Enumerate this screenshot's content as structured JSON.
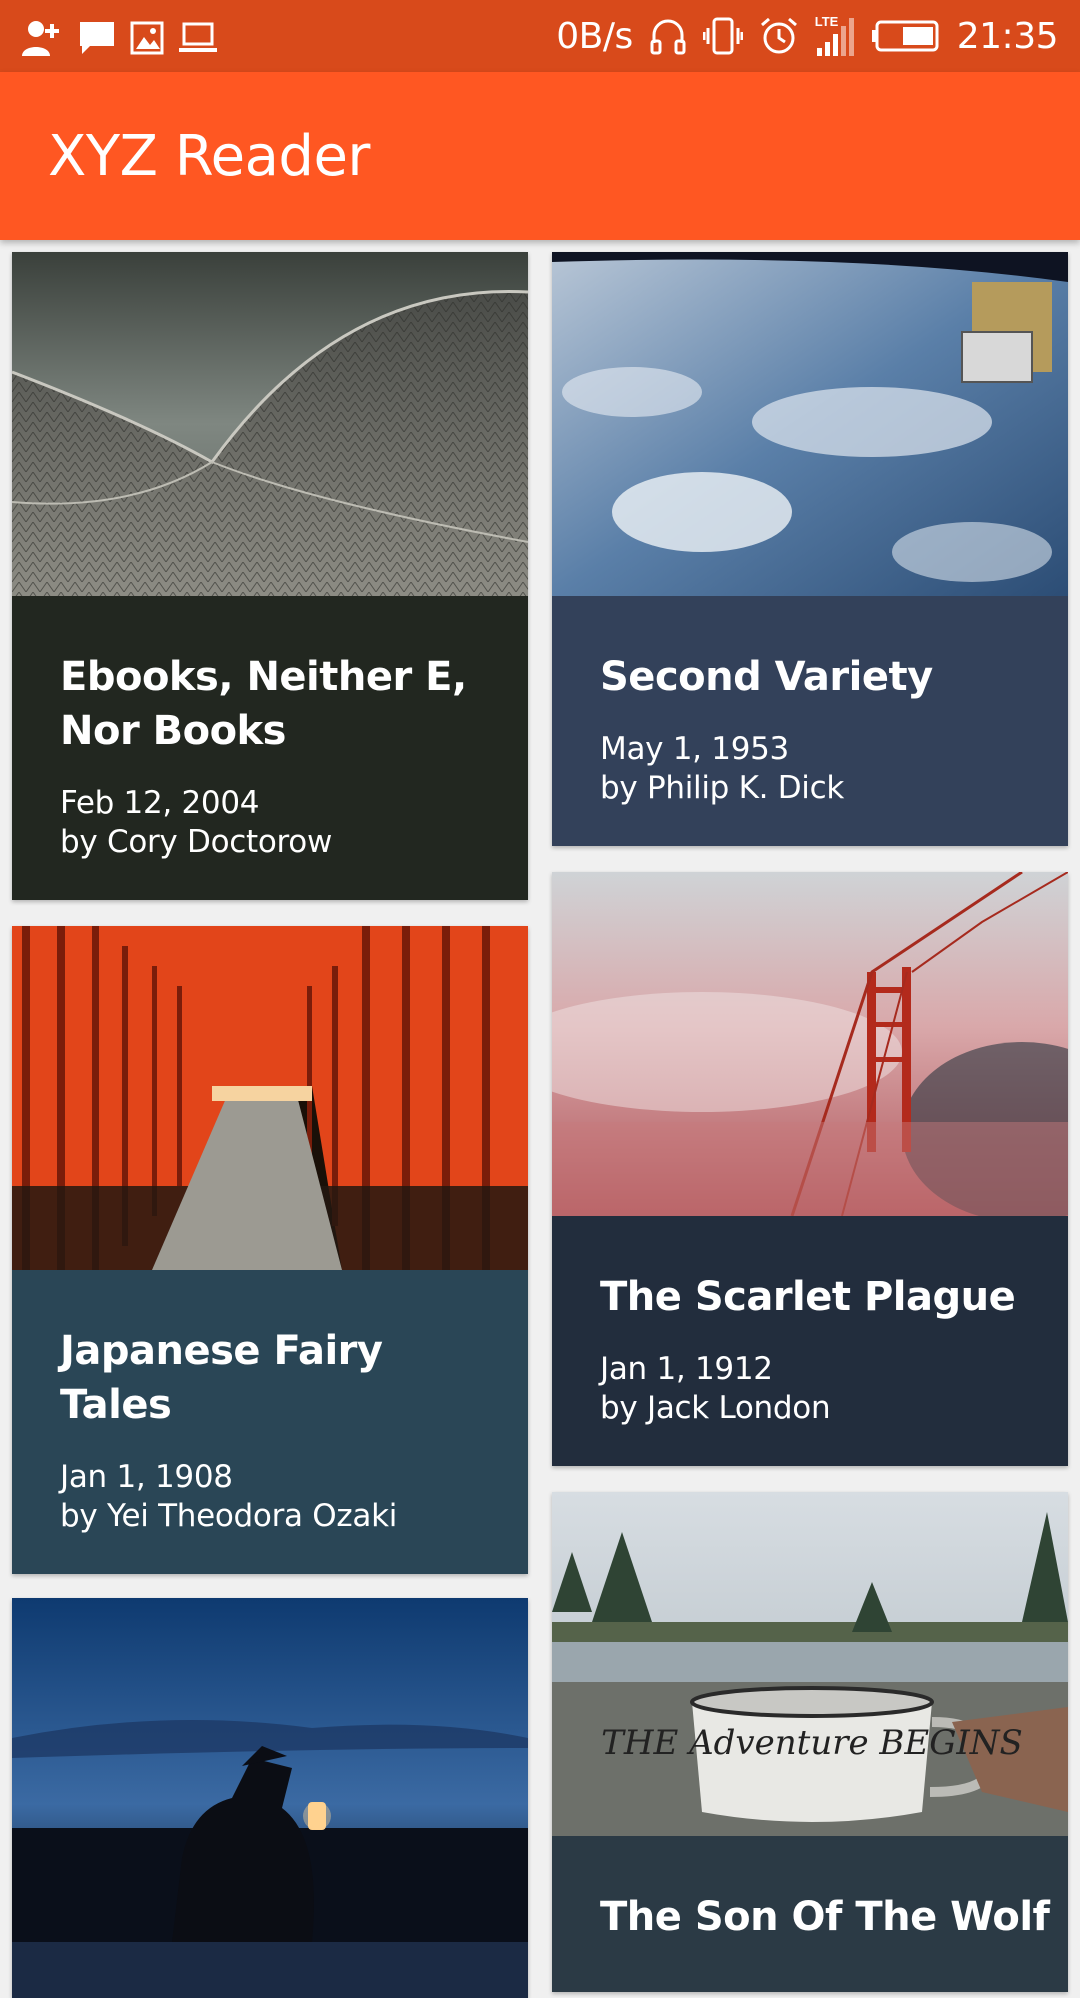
{
  "status_bar": {
    "speed": "0B/s",
    "network": "LTE",
    "time": "21:35",
    "left_icons": [
      "add-user-icon",
      "message-icon",
      "image-icon",
      "laptop-icon"
    ],
    "right_icons": [
      "headset-icon",
      "vibrate-icon",
      "alarm-icon",
      "signal-icon",
      "battery-icon"
    ],
    "background": "#d84a1b"
  },
  "app_bar": {
    "title": "XYZ Reader",
    "color": "#ff5722"
  },
  "articles": [
    {
      "title": "Ebooks, Neither E, Nor Books",
      "date": "Feb 12, 2004",
      "author": "by Cory Doctorow",
      "meta_color": "#222720",
      "image": "architecture-roof-photo"
    },
    {
      "title": "Second Variety",
      "date": "May 1, 1953",
      "author": "by Philip K. Dick",
      "meta_color": "#33415a",
      "image": "earth-from-space-photo"
    },
    {
      "title": "Japanese Fairy Tales",
      "date": "Jan 1, 1908",
      "author": "by Yei Theodora Ozaki",
      "meta_color": "#2a4656",
      "image": "torii-gates-photo"
    },
    {
      "title": "The Scarlet Plague",
      "date": "Jan 1, 1912",
      "author": "by Jack London",
      "meta_color": "#222d3d",
      "image": "golden-gate-fog-photo"
    },
    {
      "title": "",
      "date": "",
      "author": "",
      "meta_color": "#1b2a44",
      "image": "lantern-night-photo"
    },
    {
      "title": "The Son Of The Wolf",
      "date": "",
      "author": "",
      "meta_color": "#2b3a45",
      "image": "adventure-mug-photo",
      "mug_text": "THE Adventure BEGINS"
    }
  ]
}
